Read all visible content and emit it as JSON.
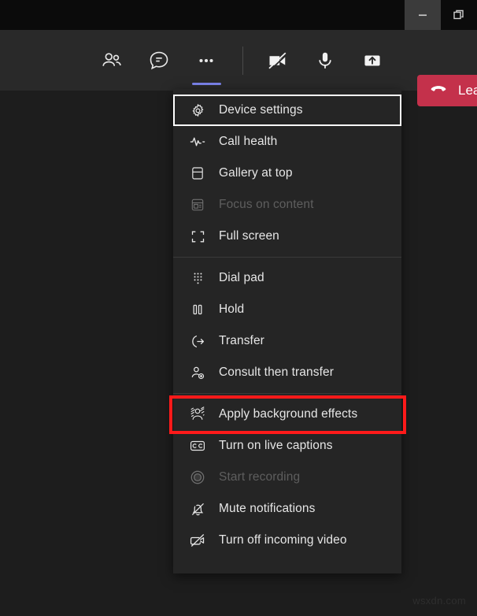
{
  "window": {
    "controls": [
      {
        "name": "minimize",
        "icon": "minimize-icon",
        "state": "hover"
      },
      {
        "name": "restore",
        "icon": "restore-icon",
        "state": "normal"
      }
    ]
  },
  "toolbar": {
    "buttons": [
      {
        "label": "Show participants",
        "icon": "people-icon",
        "active": false
      },
      {
        "label": "Show conversation",
        "icon": "chat-icon",
        "active": false
      },
      {
        "label": "More actions",
        "icon": "more-options-icon",
        "active": true
      },
      {
        "label": "Turn camera on",
        "icon": "camera-off-icon",
        "active": false
      },
      {
        "label": "Mute",
        "icon": "microphone-icon",
        "active": false
      },
      {
        "label": "Share content",
        "icon": "share-tray-icon",
        "active": false
      }
    ],
    "leave": {
      "label": "Leave",
      "icon": "hang-up-icon",
      "color": "#c4314b"
    }
  },
  "menu": {
    "accent_focus_color": "#ffffff",
    "highlight_color": "#ff1a1a",
    "groups": [
      {
        "items": [
          {
            "label": "Device settings",
            "icon": "gear-icon",
            "disabled": false,
            "focused": true,
            "highlighted": false
          },
          {
            "label": "Call health",
            "icon": "pulse-icon",
            "disabled": false,
            "focused": false,
            "highlighted": false
          },
          {
            "label": "Gallery at top",
            "icon": "gallery-top-icon",
            "disabled": false,
            "focused": false,
            "highlighted": false
          },
          {
            "label": "Focus on content",
            "icon": "focus-content-icon",
            "disabled": true,
            "focused": false,
            "highlighted": false
          },
          {
            "label": "Full screen",
            "icon": "full-screen-icon",
            "disabled": false,
            "focused": false,
            "highlighted": false
          }
        ]
      },
      {
        "items": [
          {
            "label": "Dial pad",
            "icon": "dial-pad-icon",
            "disabled": false,
            "focused": false,
            "highlighted": false
          },
          {
            "label": "Hold",
            "icon": "hold-icon",
            "disabled": false,
            "focused": false,
            "highlighted": false
          },
          {
            "label": "Transfer",
            "icon": "transfer-icon",
            "disabled": false,
            "focused": false,
            "highlighted": false
          },
          {
            "label": "Consult then transfer",
            "icon": "consult-transfer-icon",
            "disabled": false,
            "focused": false,
            "highlighted": false
          }
        ]
      },
      {
        "items": [
          {
            "label": "Apply background effects",
            "icon": "background-effects-icon",
            "disabled": false,
            "focused": false,
            "highlighted": true
          },
          {
            "label": "Turn on live captions",
            "icon": "closed-captions-icon",
            "disabled": false,
            "focused": false,
            "highlighted": false
          },
          {
            "label": "Start recording",
            "icon": "record-icon",
            "disabled": true,
            "focused": false,
            "highlighted": false
          },
          {
            "label": "Mute notifications",
            "icon": "bell-off-icon",
            "disabled": false,
            "focused": false,
            "highlighted": false
          },
          {
            "label": "Turn off incoming video",
            "icon": "video-off-icon",
            "disabled": false,
            "focused": false,
            "highlighted": false
          }
        ]
      }
    ]
  },
  "watermark": {
    "text": "wsxdn.com"
  }
}
